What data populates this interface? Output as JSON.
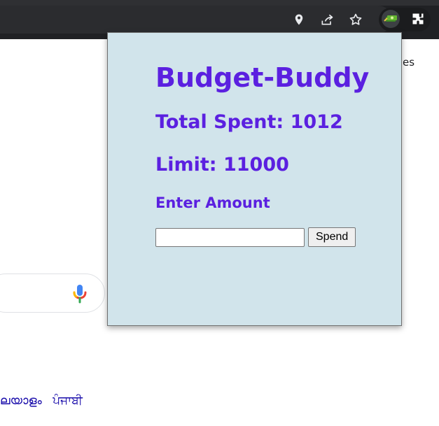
{
  "browser": {
    "background_text": "es",
    "language_links": [
      "ലയാളം",
      "ਪੰਜਾਬੀ"
    ]
  },
  "popup": {
    "title": "Budget-Buddy",
    "total_spent_label": "Total Spent:",
    "total_spent_value": "1012",
    "limit_label": "Limit:",
    "limit_value": "11000",
    "amount_label": "Enter Amount",
    "amount_input_value": "",
    "amount_input_placeholder": "",
    "spend_button_label": "Spend"
  },
  "colors": {
    "accent": "#5b20e0",
    "popup_background": "#d1e4eb",
    "toolbar_background": "#202124",
    "link_blue": "#1a0dab"
  },
  "icons": {
    "location": "location-pin-icon",
    "share": "share-icon",
    "bookmark": "star-icon",
    "extension": "budget-buddy-extension-icon",
    "extensions_menu": "puzzle-piece-icon",
    "voice_search": "microphone-icon"
  }
}
